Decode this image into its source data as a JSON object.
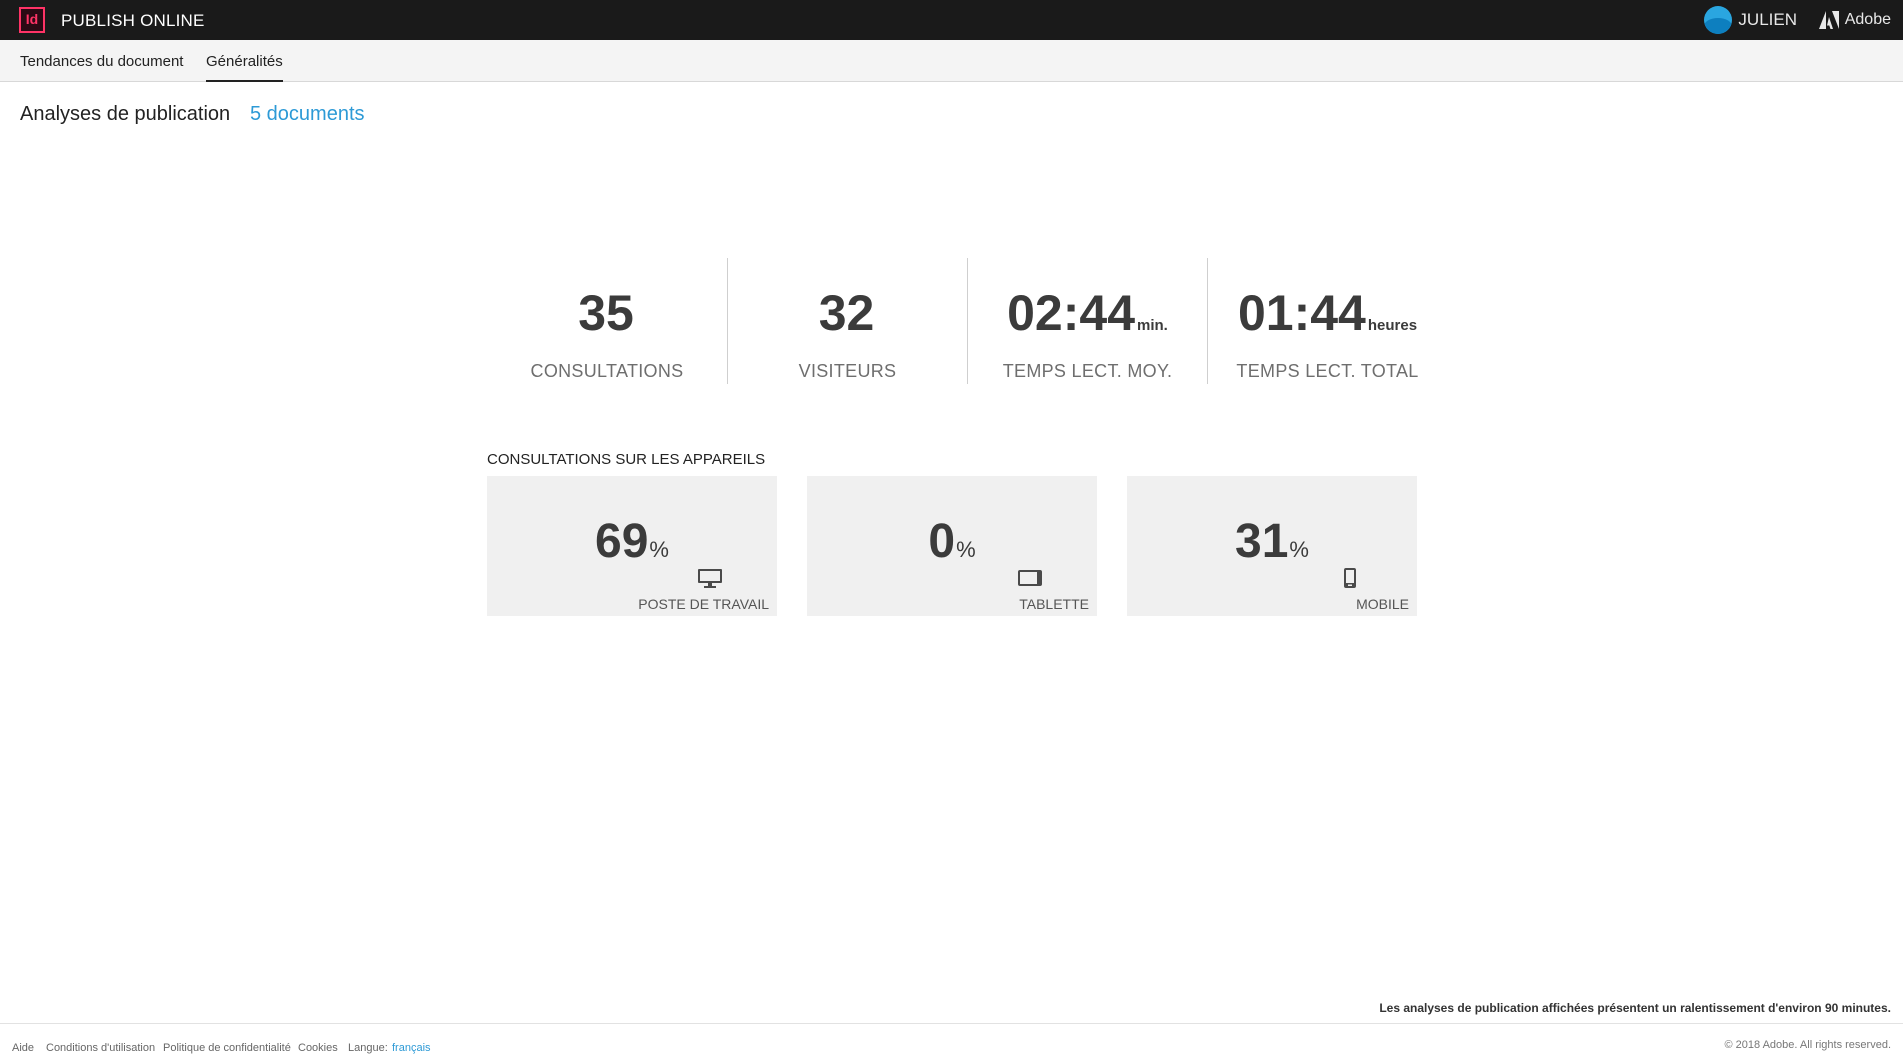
{
  "header": {
    "logo_text": "Id",
    "app_title": "PUBLISH ONLINE",
    "user_name": "JULIEN",
    "brand": "Adobe"
  },
  "tabs": [
    {
      "label": "Tendances du document",
      "active": false
    },
    {
      "label": "Généralités",
      "active": true
    }
  ],
  "page": {
    "title": "Analyses de publication",
    "doc_count": "5 documents"
  },
  "stats": [
    {
      "value": "35",
      "unit": "",
      "label": "CONSULTATIONS"
    },
    {
      "value": "32",
      "unit": "",
      "label": "VISITEURS"
    },
    {
      "value": "02:44",
      "unit": "min.",
      "label": "TEMPS LECT. MOY."
    },
    {
      "value": "01:44",
      "unit": "heures",
      "label": "TEMPS LECT. TOTAL"
    }
  ],
  "devices": {
    "title": "CONSULTATIONS SUR LES APPAREILS",
    "items": [
      {
        "value": "69",
        "sign": "%",
        "label": "POSTE DE TRAVAIL",
        "icon": "desktop-icon"
      },
      {
        "value": "0",
        "sign": "%",
        "label": "TABLETTE",
        "icon": "tablet-icon"
      },
      {
        "value": "31",
        "sign": "%",
        "label": "MOBILE",
        "icon": "mobile-icon"
      }
    ]
  },
  "footer": {
    "note": "Les analyses de publication affichées présentent un ralentissement d'environ 90 minutes.",
    "links": [
      "Aide",
      "Conditions d'utilisation",
      "Politique de confidentialité",
      "Cookies"
    ],
    "language_label": "Langue:",
    "language_value": "français",
    "copyright": "© 2018 Adobe. All rights reserved."
  },
  "colors": {
    "accent": "#2d9ad6",
    "logo": "#ff3366",
    "topbar": "#1a1a1a"
  }
}
